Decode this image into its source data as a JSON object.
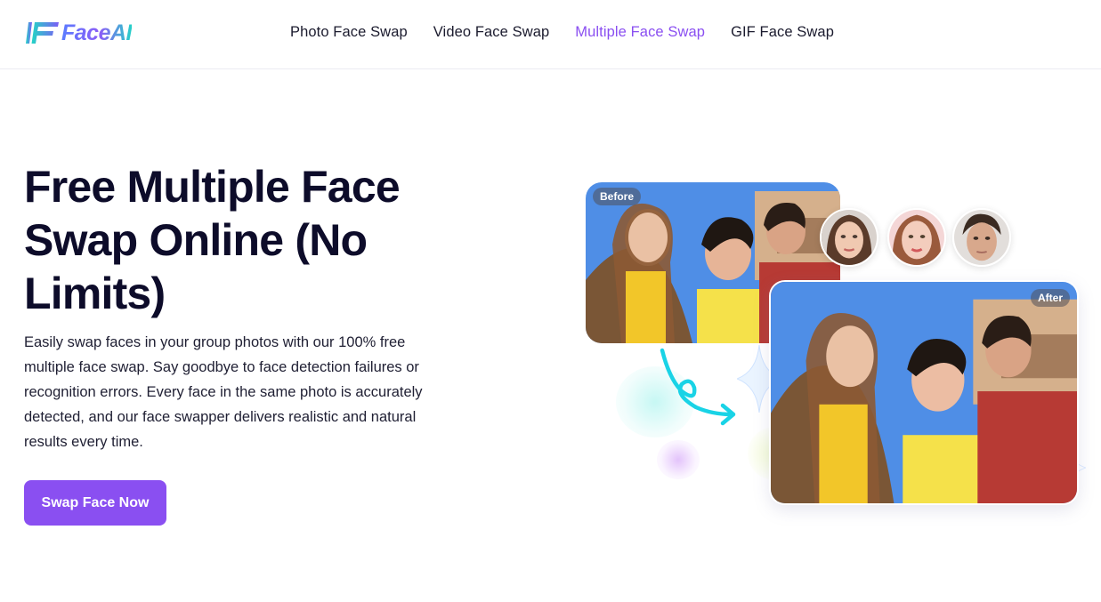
{
  "brand": {
    "name": "FaceAI"
  },
  "nav": {
    "items": [
      {
        "label": "Photo Face Swap",
        "active": false
      },
      {
        "label": "Video Face Swap",
        "active": false
      },
      {
        "label": "Multiple Face Swap",
        "active": true
      },
      {
        "label": "GIF Face Swap",
        "active": false
      }
    ]
  },
  "hero": {
    "title": "Free Multiple Face Swap Online (No Limits)",
    "description": "Easily swap faces in your group photos with our 100% free multiple face swap. Say goodbye to face detection failures or recognition errors. Every face in the same photo is accurately detected, and our face swapper delivers realistic and natural results every time.",
    "cta_label": "Swap Face Now"
  },
  "visual": {
    "before_label": "Before",
    "after_label": "After",
    "face_thumbnails": [
      "face-thumbnail-1",
      "face-thumbnail-2",
      "face-thumbnail-3"
    ]
  },
  "colors": {
    "accent": "#8a4ff1",
    "title": "#0d0c2a",
    "arrow": "#19d3e6",
    "sky": "#4f8ee6"
  }
}
